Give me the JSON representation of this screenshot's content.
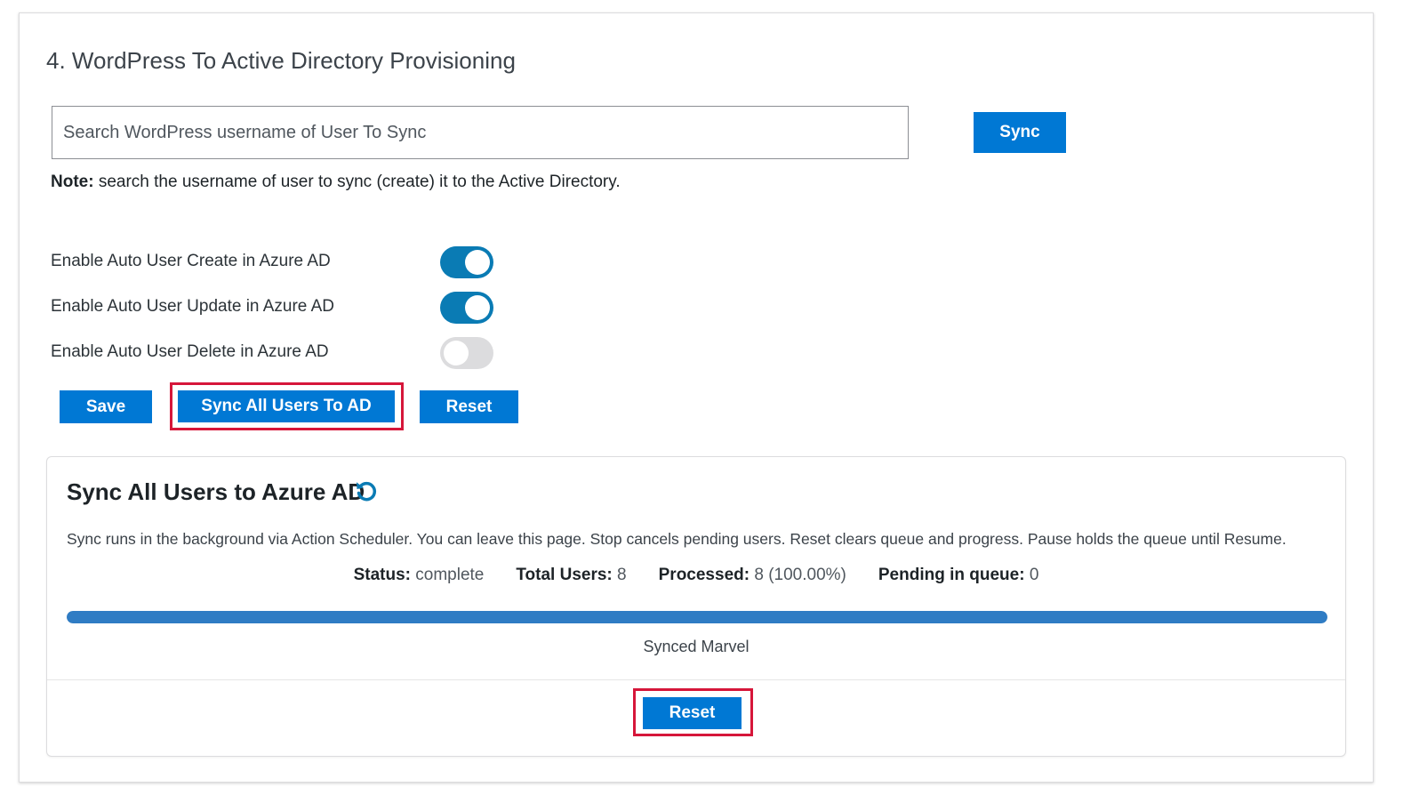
{
  "section": {
    "title": "4. WordPress To Active Directory Provisioning"
  },
  "search": {
    "placeholder": "Search WordPress username of User To Sync",
    "value": "",
    "sync_button": "Sync",
    "note_label": "Note:",
    "note_text": " search the username of user to sync (create) it to the Active Directory."
  },
  "toggles": [
    {
      "label": "Enable Auto User Create in Azure AD",
      "enabled": true
    },
    {
      "label": "Enable Auto User Update in Azure AD",
      "enabled": true
    },
    {
      "label": "Enable Auto User Delete in Azure AD",
      "enabled": false
    }
  ],
  "actions": {
    "save": "Save",
    "sync_all": "Sync All Users To AD",
    "reset": "Reset"
  },
  "sync_card": {
    "title": "Sync All Users to Azure AD",
    "refresh_icon": "refresh-icon",
    "description": "Sync runs in the background via Action Scheduler. You can leave this page. Stop cancels pending users. Reset clears queue and progress. Pause holds the queue until Resume.",
    "status_label": "Status:",
    "status_value": " complete",
    "total_label": "Total Users:",
    "total_value": " 8",
    "processed_label": "Processed:",
    "processed_value": " 8 (100.00%)",
    "pending_label": "Pending in queue:",
    "pending_value": " 0",
    "progress_percent": 100,
    "progress_text": "Synced Marvel",
    "reset_button": "Reset"
  },
  "colors": {
    "primary_button": "#0078d4",
    "toggle_on": "#0a7bb4",
    "toggle_off": "#dcdcde",
    "highlight": "#d6163a",
    "progress": "#2f7cc4"
  }
}
